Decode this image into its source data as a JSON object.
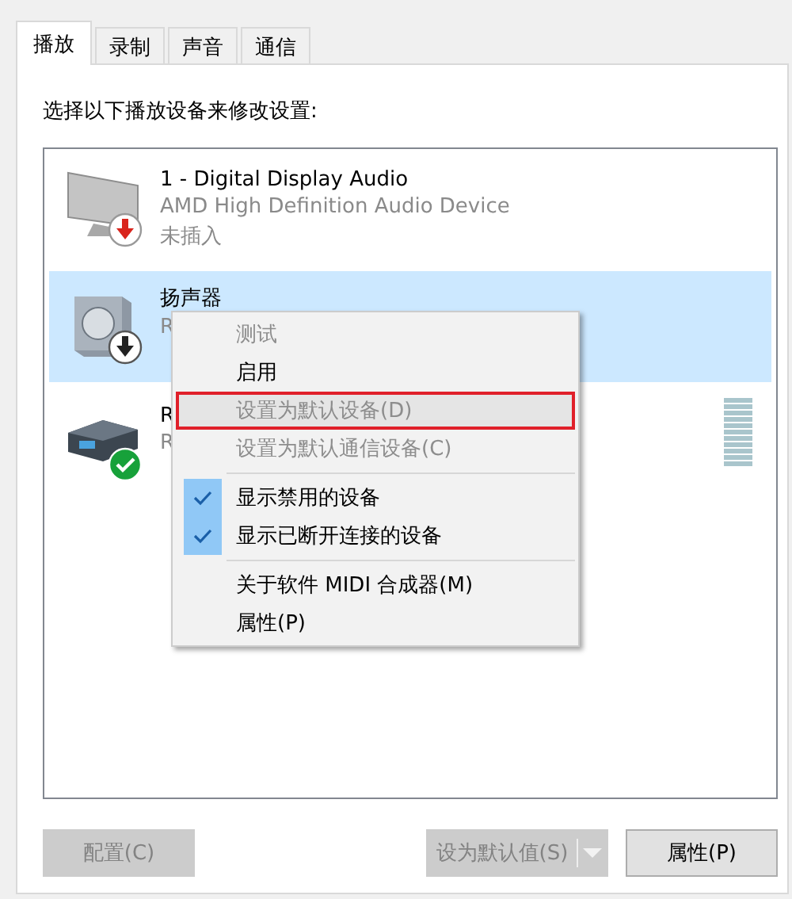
{
  "tabs": [
    {
      "label": "播放",
      "selected": true
    },
    {
      "label": "录制",
      "selected": false
    },
    {
      "label": "声音",
      "selected": false
    },
    {
      "label": "通信",
      "selected": false
    }
  ],
  "instruction": "选择以下播放设备来修改设置:",
  "devices": [
    {
      "kind": "monitor",
      "plugged_in": false,
      "disabled": false,
      "is_default": false,
      "selected": false,
      "name": "1 - Digital Display Audio",
      "description": "AMD High Definition Audio Device",
      "state": "未插入"
    },
    {
      "kind": "speaker",
      "plugged_in": true,
      "disabled": true,
      "is_default": false,
      "selected": true,
      "name": "扬声器",
      "description": "R"
    },
    {
      "kind": "receiver",
      "plugged_in": true,
      "disabled": false,
      "is_default": true,
      "selected": false,
      "name": "R",
      "description": "R"
    }
  ],
  "context_menu": [
    {
      "kind": "item",
      "label": "测试",
      "disabled": true,
      "checked": false,
      "highlighted": false
    },
    {
      "kind": "item",
      "label": "启用",
      "disabled": false,
      "checked": false,
      "highlighted": false
    },
    {
      "kind": "item",
      "label": "设置为默认设备(D)",
      "disabled": true,
      "checked": false,
      "highlighted": true
    },
    {
      "kind": "item",
      "label": "设置为默认通信设备(C)",
      "disabled": true,
      "checked": false,
      "highlighted": false
    },
    {
      "kind": "separator"
    },
    {
      "kind": "item",
      "label": "显示禁用的设备",
      "disabled": false,
      "checked": true,
      "highlighted": false
    },
    {
      "kind": "item",
      "label": "显示已断开连接的设备",
      "disabled": false,
      "checked": true,
      "highlighted": false
    },
    {
      "kind": "separator"
    },
    {
      "kind": "item",
      "label": "关于软件 MIDI 合成器(M)",
      "disabled": false,
      "checked": false,
      "highlighted": false
    },
    {
      "kind": "item",
      "label": "属性(P)",
      "disabled": false,
      "checked": false,
      "highlighted": false
    }
  ],
  "buttons": {
    "configure": {
      "label": "配置(C)",
      "disabled": true
    },
    "set_default": {
      "label": "设为默认值(S)",
      "disabled": true
    },
    "properties": {
      "label": "属性(P)",
      "disabled": false
    }
  }
}
